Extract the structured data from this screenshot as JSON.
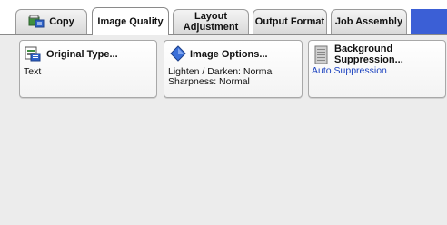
{
  "tabs": [
    {
      "label": "Copy",
      "active": false
    },
    {
      "label": "Image Quality",
      "active": true
    },
    {
      "label": "Layout\nAdjustment",
      "active": false
    },
    {
      "label": "Output Format",
      "active": false
    },
    {
      "label": "Job Assembly",
      "active": false
    }
  ],
  "cards": {
    "original_type": {
      "title": "Original Type...",
      "value": "Text"
    },
    "image_options": {
      "title": "Image Options...",
      "line1": "Lighten / Darken: Normal",
      "line2": "Sharpness: Normal"
    },
    "background": {
      "title_line1": "Background",
      "title_line2": "Suppression...",
      "value": "Auto Suppression"
    }
  },
  "colors": {
    "accent": "#3b5fd6",
    "value_blue": "#1e44c0"
  },
  "icons": [
    "copy-icon",
    "original-type-icon",
    "image-options-icon",
    "background-suppression-icon"
  ]
}
